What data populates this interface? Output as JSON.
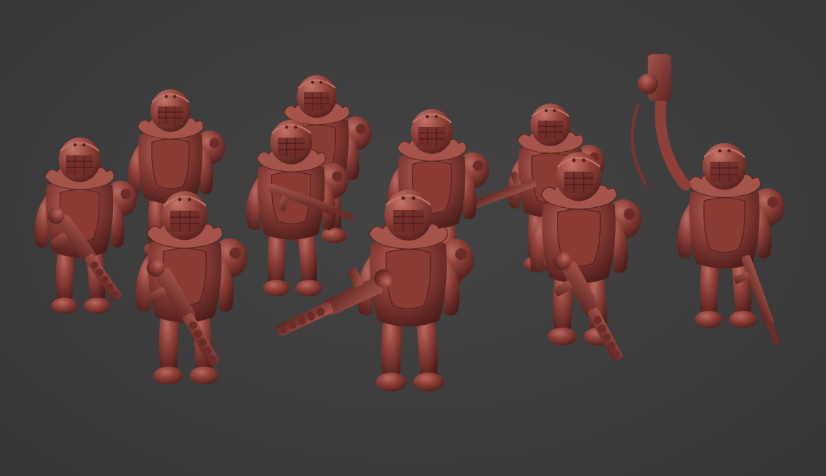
{
  "scene": {
    "description_free": true,
    "background_color": "#3d3d3d",
    "material_color": "#8e3f38",
    "material_highlight": "#b86a60",
    "material_shadow": "#4f1e1b",
    "figure_count": 10
  },
  "figures": [
    {
      "id": "left-heavy-gunner",
      "weapon": "heavy-stubber"
    },
    {
      "id": "back-left-trooper",
      "weapon": "none"
    },
    {
      "id": "front-left-gunner",
      "weapon": "heavy-stubber"
    },
    {
      "id": "back-center-trooper",
      "weapon": "none"
    },
    {
      "id": "center-rifleman",
      "weapon": "rifle"
    },
    {
      "id": "center-back-trooper",
      "weapon": "none"
    },
    {
      "id": "front-center-gunner",
      "weapon": "heavy-stubber"
    },
    {
      "id": "right-back-trooper",
      "weapon": "rifle"
    },
    {
      "id": "right-front-gunner",
      "weapon": "heavy-stubber"
    },
    {
      "id": "far-right-flamer",
      "weapon": "flamer"
    }
  ]
}
